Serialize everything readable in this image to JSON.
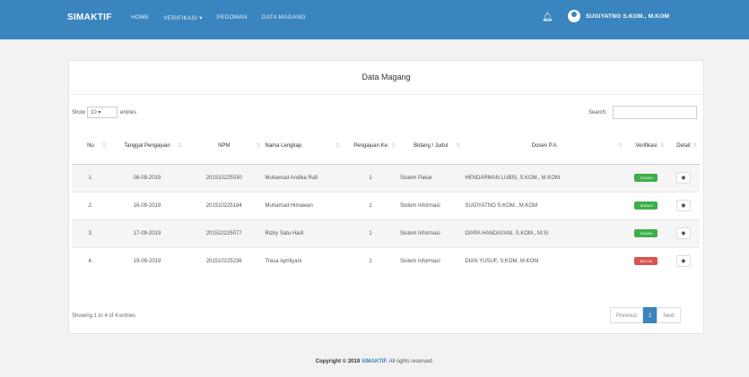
{
  "nav": {
    "brand": "SIMAKTIF",
    "links": [
      "HOME",
      "VERIFIKASI ▾",
      "PEDOMAN",
      "DATA MAGANG"
    ],
    "user": "SUGIYATNO S.KOM., M.KOM"
  },
  "panel": {
    "title": "Data Magang"
  },
  "controls": {
    "show_label": "Show",
    "show_value": "10",
    "entries_label": "entries",
    "search_label": "Search:"
  },
  "table": {
    "headers": [
      "No",
      "Tanggal Pengajuan",
      "NPM",
      "Nama Lengkap",
      "Pengajuan Ke",
      "Bidang / Judul",
      "Dosen P.A",
      "Verifikasi",
      "Detail"
    ],
    "rows": [
      {
        "no": "1.",
        "tanggal": "08-09-2019",
        "npm": "201510225030",
        "nama": "Muhamad Andika Rafi",
        "ke": "1",
        "bidang": "Sistem Pakar",
        "dosen": "HENDARMAN LUBIS, S.KOM., M.KOM",
        "status": "SUDAH",
        "status_color": "#3fae49"
      },
      {
        "no": "2.",
        "tanggal": "16-09-2019",
        "npm": "201510225184",
        "nama": "Muhamad Himawan",
        "ke": "1",
        "bidang": "Sistem Informasi",
        "dosen": "SUGIYATNO S.KOM., M.KOM",
        "status": "SUDAH",
        "status_color": "#3fae49"
      },
      {
        "no": "3.",
        "tanggal": "17-09-2019",
        "npm": "201510225077",
        "nama": "Rizky Satu Hadi",
        "ke": "1",
        "bidang": "Sistem Informasi",
        "dosen": "DIXPA HANDAYANI, S.KOM., M.SI",
        "status": "SUDAH",
        "status_color": "#3fae49"
      },
      {
        "no": "4.",
        "tanggal": "19-09-2019",
        "npm": "201510225236",
        "nama": "Tresa Apriliyani",
        "ke": "1",
        "bidang": "Sistem Informasi",
        "dosen": "DIAN YUSUF, S.KOM, M.KOM",
        "status": "BELUM",
        "status_color": "#d9534f"
      }
    ],
    "detail_icon": "eye-icon"
  },
  "footer": {
    "info": "Showing 1 to 4 of 4 entries",
    "prev": "Previous",
    "page": "1",
    "next": "Next",
    "copyright": "Copyright © 2019",
    "brand": "SIMAKTIF.",
    "rights": "All rights reserved."
  },
  "colors": {
    "primary": "#3a85bd",
    "success": "#3fae49",
    "danger": "#d9534f"
  }
}
